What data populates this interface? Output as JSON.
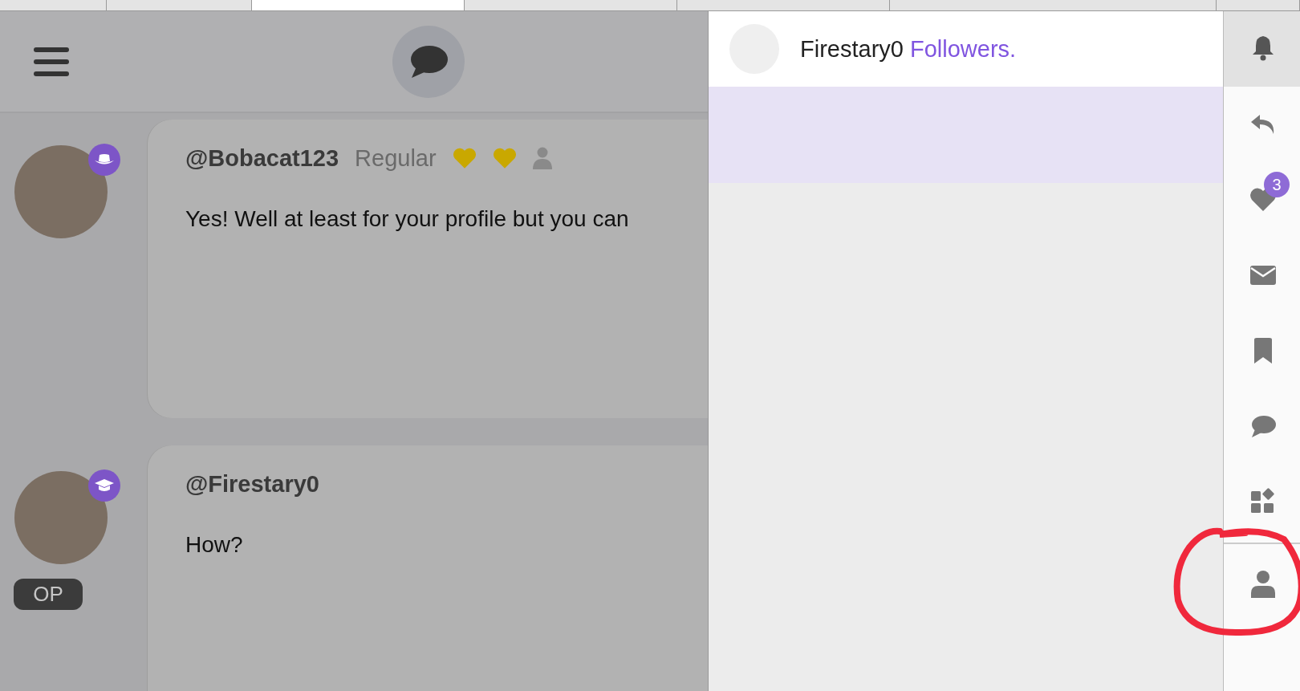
{
  "browser_tabs": [
    {
      "selected": false
    },
    {
      "selected": false
    },
    {
      "selected": true
    },
    {
      "selected": false
    },
    {
      "selected": false
    },
    {
      "selected": false
    },
    {
      "selected": false
    }
  ],
  "posts": [
    {
      "username": "@Bobacat123",
      "role": "Regular",
      "avatar_badge": {
        "kind": "hat"
      },
      "role_icons": [
        {
          "kind": "heart"
        },
        {
          "kind": "heart"
        },
        {
          "kind": "person"
        }
      ],
      "text": "Yes! Well at least for your profile but you can"
    },
    {
      "username": "@Firestary0",
      "avatar_badge": {
        "kind": "cap"
      },
      "text": "How?",
      "op": "OP"
    }
  ],
  "notifications": [
    {
      "name": "Firestary0",
      "action": "Followers."
    }
  ],
  "rail": [
    {
      "kind": "bell",
      "selected": true
    },
    {
      "kind": "reply",
      "selected": false
    },
    {
      "kind": "heart",
      "selected": false,
      "badge": "3"
    },
    {
      "kind": "mail",
      "selected": false
    },
    {
      "kind": "bookmark",
      "selected": false
    },
    {
      "kind": "chat",
      "selected": false
    },
    {
      "kind": "widgets",
      "selected": false
    },
    {
      "kind": "person",
      "selected": false
    }
  ]
}
